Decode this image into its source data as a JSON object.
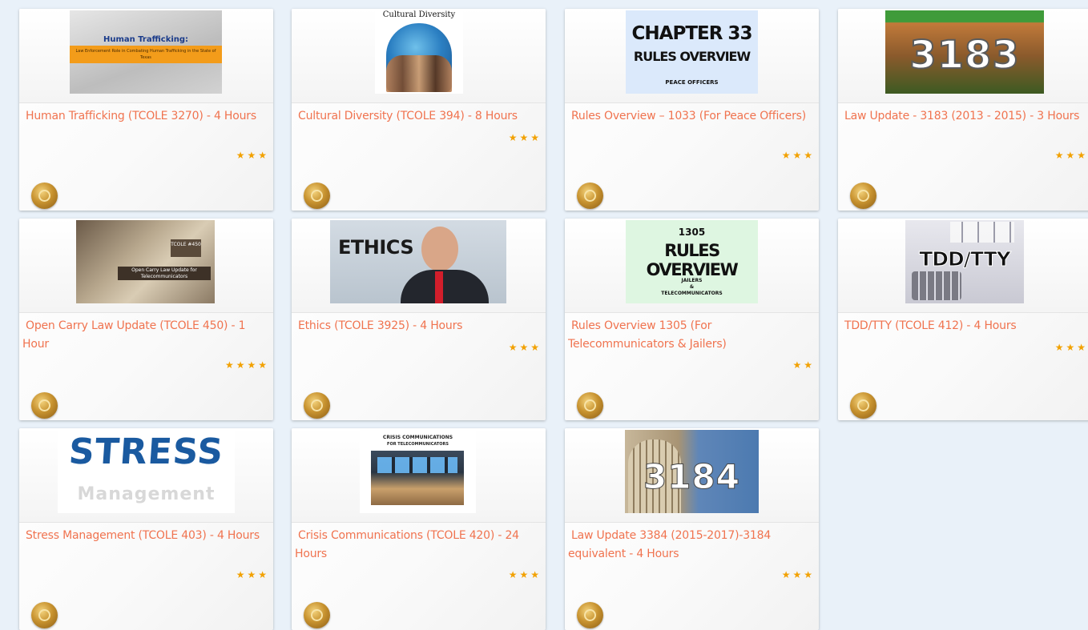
{
  "colors": {
    "background": "#e9f1f9",
    "title": "#f0734f",
    "star": "#f2a100",
    "medal": "#c89330"
  },
  "courses": [
    {
      "title": "Human Trafficking (TCOLE 3270) - 4 Hours",
      "rating": 3,
      "stars": "★★★",
      "thumb": {
        "heading": "Human Trafficking:",
        "subtitle": "Law Enforcement Role in Combating Human Trafficking in the State of Texas"
      }
    },
    {
      "title": "Cultural Diversity (TCOLE 394) - 8 Hours",
      "rating": 3,
      "stars": "★★★",
      "thumb": {
        "heading": "Cultural Diversity"
      }
    },
    {
      "title": "Rules Overview – 1033 (For Peace Officers)",
      "rating": 3,
      "stars": "★★★",
      "thumb": {
        "line1": "CHAPTER 33",
        "line2": "RULES OVERVIEW",
        "line3": "PEACE OFFICERS"
      }
    },
    {
      "title": "Law Update - 3183 (2013 - 2015) - 3 Hours",
      "rating": 3,
      "stars": "★★★",
      "thumb": {
        "number": "3183"
      }
    },
    {
      "title": "Open Carry Law Update (TCOLE 450) - 1 Hour",
      "rating": 4,
      "stars": "★★★★",
      "thumb": {
        "tag": "TCOLE #450",
        "banner": "Open Carry Law Update for Telecommunicators"
      }
    },
    {
      "title": "Ethics (TCOLE 3925) - 4 Hours",
      "rating": 3,
      "stars": "★★★",
      "thumb": {
        "heading": "ETHICS"
      }
    },
    {
      "title": "Rules Overview 1305 (For Telecommunicators & Jailers)",
      "rating": 2,
      "stars": "★★",
      "thumb": {
        "line1": "1305",
        "line2": "RULES OVERVIEW",
        "line3": "JAILERS",
        "line4": "&",
        "line5": "TELECOMMUNICATORS"
      }
    },
    {
      "title": "TDD/TTY (TCOLE 412) - 4 Hours",
      "rating": 3,
      "stars": "★★★",
      "thumb": {
        "heading": "TDD/TTY"
      }
    },
    {
      "title": "Stress Management (TCOLE 403) - 4 Hours",
      "rating": 3,
      "stars": "★★★",
      "thumb": {
        "line1": "STRESS",
        "line2": "Management"
      }
    },
    {
      "title": "Crisis Communications (TCOLE 420) - 24 Hours",
      "rating": 3,
      "stars": "★★★",
      "thumb": {
        "line1": "CRISIS COMMUNICATIONS",
        "line2": "FOR TELECOMMUNICATORS"
      }
    },
    {
      "title": "Law Update 3384 (2015-2017)-3184 equivalent - 4 Hours",
      "rating": 3,
      "stars": "★★★",
      "thumb": {
        "number": "3184"
      }
    }
  ]
}
